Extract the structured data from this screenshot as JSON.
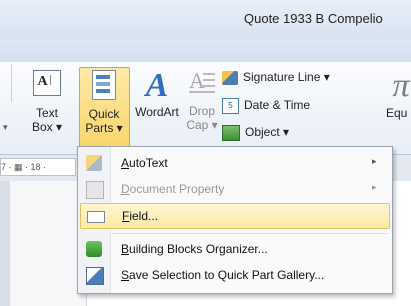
{
  "window": {
    "title": "Quote 1933 B Compelio"
  },
  "ribbon": {
    "textbox": {
      "line1": "Text",
      "line2": "Box ▾"
    },
    "quickparts": {
      "line1": "Quick",
      "line2": "Parts ▾"
    },
    "wordart": {
      "label": "WordArt"
    },
    "dropcap": {
      "line1": "Drop",
      "line2": "Cap ▾"
    },
    "signature": {
      "label": "Signature Line ▾"
    },
    "datetime": {
      "label": "Date & Time"
    },
    "object": {
      "label": "Object ▾"
    },
    "equation": {
      "label": "Equ"
    }
  },
  "ruler": {
    "text": "7 · ▦ · 18 ·"
  },
  "menu": {
    "items": [
      {
        "label": "AutoText",
        "access": "A",
        "rest": "utoText",
        "submenu": "▸",
        "disabled": false
      },
      {
        "label": "Document Property",
        "access": "D",
        "rest": "ocument Property",
        "submenu": "▸",
        "disabled": true
      },
      {
        "label": "Field...",
        "access": "F",
        "rest": "ield...",
        "highlighted": true
      },
      {
        "label": "Building Blocks Organizer...",
        "access": "B",
        "rest": "uilding Blocks Organizer..."
      },
      {
        "label": "Save Selection to Quick Part Gallery...",
        "access": "S",
        "rest": "ave Selection to Quick Part Gallery..."
      }
    ]
  }
}
